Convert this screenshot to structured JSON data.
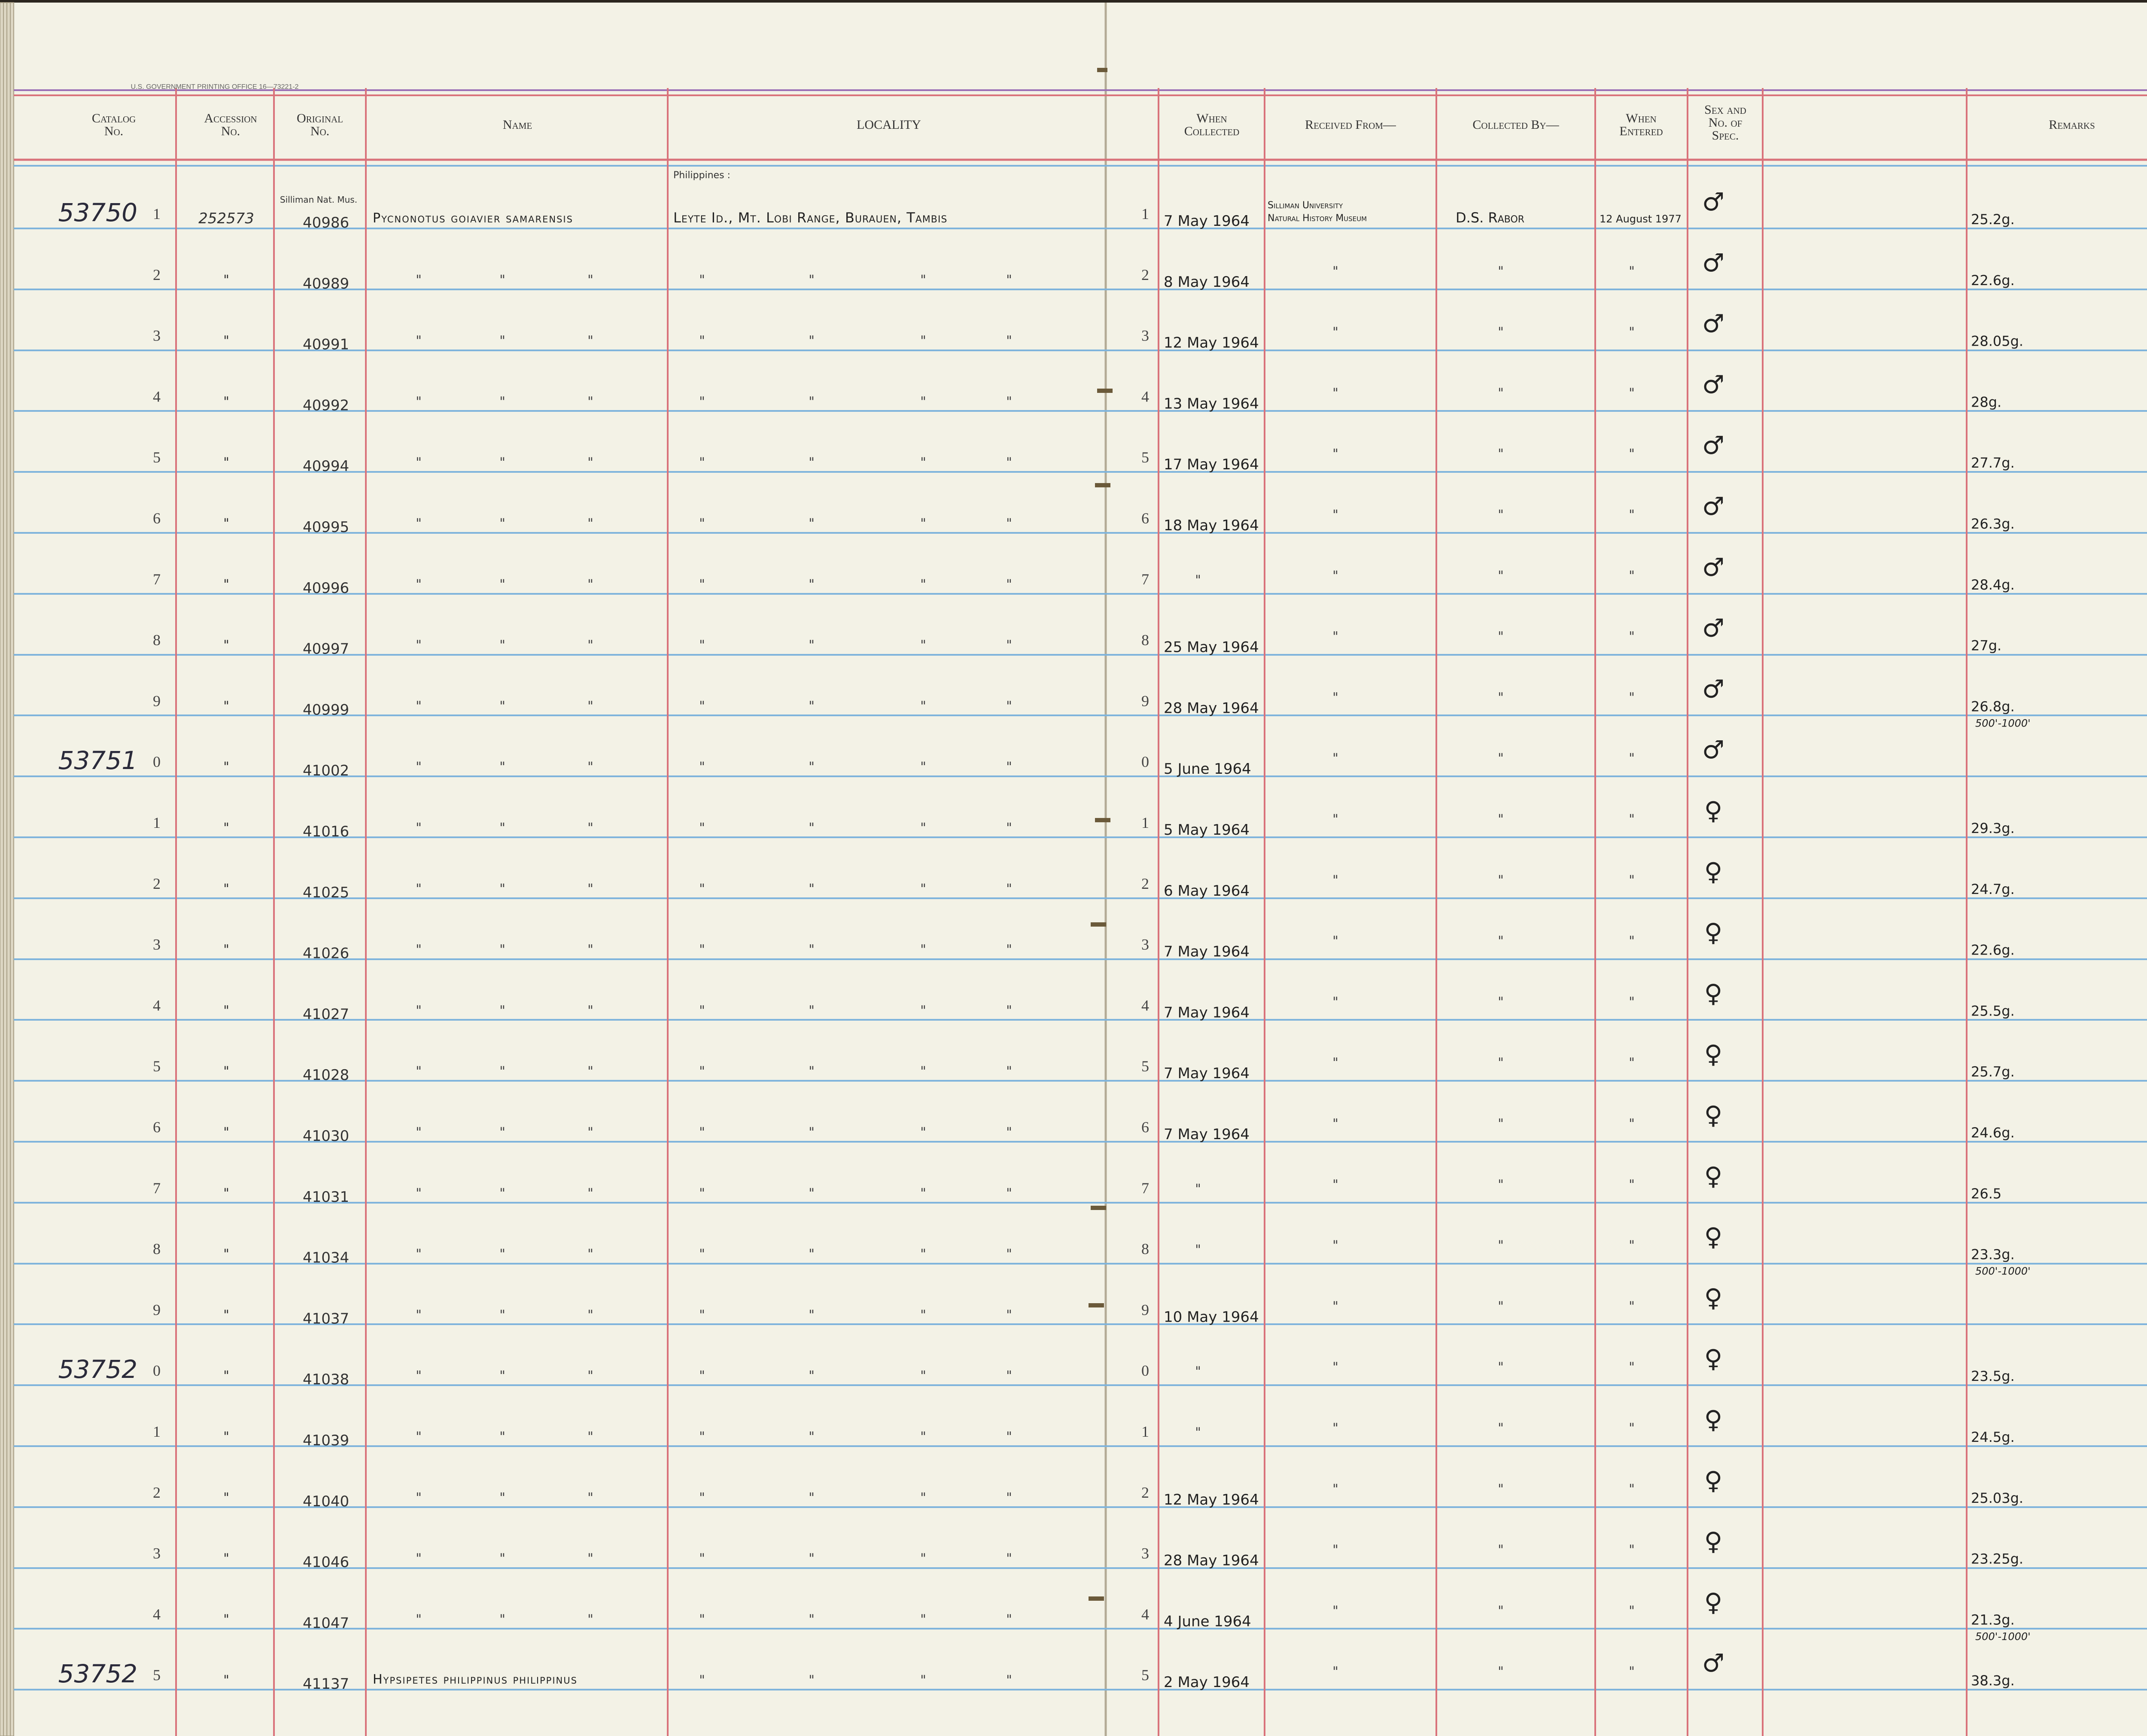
{
  "printer_line": "U.S. GOVERNMENT PRINTING OFFICE    16—73221-2",
  "headers": {
    "catalog": [
      "Catalog",
      "No."
    ],
    "accession": [
      "Accession",
      "No."
    ],
    "original": [
      "Original",
      "No."
    ],
    "name": [
      "Name"
    ],
    "locality": [
      "LOCALITY"
    ],
    "when_collected": [
      "When",
      "Collected"
    ],
    "received_from": [
      "Received From—"
    ],
    "collected_by": [
      "Collected By—"
    ],
    "when_entered": [
      "When",
      "Entered"
    ],
    "sex": [
      "Sex and",
      "No. of",
      "Spec."
    ],
    "remarks": [
      "Remarks"
    ]
  },
  "annotations": {
    "original_header_note": "Silliman Nat. Mus.",
    "locality_header_note": "Philippines :"
  },
  "rows": [
    {
      "cat_base": "53750",
      "digit": "1",
      "acc": "252573",
      "orig": "40986",
      "name": "Pycnonotus goiavier samarensis",
      "locality": "Leyte Id., Mt. Lobi Range, Burauen, Tambis",
      "rdigit": "1",
      "date": "7 May 1964",
      "received": "Silliman University Natural History Museum",
      "collector": "D.S. Rabor",
      "entered": "12 August 1977",
      "sex": "♂",
      "remarks": "25.2g."
    },
    {
      "cat_base": "",
      "digit": "2",
      "acc": "\"",
      "orig": "40989",
      "name": "\"",
      "locality": "\"",
      "rdigit": "2",
      "date": "8 May 1964",
      "received": "\"",
      "collector": "\"",
      "entered": "\"",
      "sex": "♂",
      "remarks": "22.6g."
    },
    {
      "cat_base": "",
      "digit": "3",
      "acc": "\"",
      "orig": "40991",
      "name": "\"",
      "locality": "\"",
      "rdigit": "3",
      "date": "12 May 1964",
      "received": "\"",
      "collector": "\"",
      "entered": "\"",
      "sex": "♂",
      "remarks": "28.05g."
    },
    {
      "cat_base": "",
      "digit": "4",
      "acc": "\"",
      "orig": "40992",
      "name": "\"",
      "locality": "\"",
      "rdigit": "4",
      "date": "13 May 1964",
      "received": "\"",
      "collector": "\"",
      "entered": "\"",
      "sex": "♂",
      "remarks": "28g."
    },
    {
      "cat_base": "",
      "digit": "5",
      "acc": "\"",
      "orig": "40994",
      "name": "\"",
      "locality": "\"",
      "rdigit": "5",
      "date": "17 May 1964",
      "received": "\"",
      "collector": "\"",
      "entered": "\"",
      "sex": "♂",
      "remarks": "27.7g."
    },
    {
      "cat_base": "",
      "digit": "6",
      "acc": "\"",
      "orig": "40995",
      "name": "\"",
      "locality": "\"",
      "rdigit": "6",
      "date": "18 May 1964",
      "received": "\"",
      "collector": "\"",
      "entered": "\"",
      "sex": "♂",
      "remarks": "26.3g."
    },
    {
      "cat_base": "",
      "digit": "7",
      "acc": "\"",
      "orig": "40996",
      "name": "\"",
      "locality": "\"",
      "rdigit": "7",
      "date": "\"",
      "received": "\"",
      "collector": "\"",
      "entered": "\"",
      "sex": "♂",
      "remarks": "28.4g."
    },
    {
      "cat_base": "",
      "digit": "8",
      "acc": "\"",
      "orig": "40997",
      "name": "\"",
      "locality": "\"",
      "rdigit": "8",
      "date": "25 May 1964",
      "received": "\"",
      "collector": "\"",
      "entered": "\"",
      "sex": "♂",
      "remarks": "27g."
    },
    {
      "cat_base": "",
      "digit": "9",
      "acc": "\"",
      "orig": "40999",
      "name": "\"",
      "locality": "\"",
      "rdigit": "9",
      "date": "28 May 1964",
      "received": "\"",
      "collector": "\"",
      "entered": "\"",
      "sex": "♂",
      "remarks": "26.8g.",
      "remarks2": "500'-1000'"
    },
    {
      "cat_base": "53751",
      "digit": "0",
      "acc": "\"",
      "orig": "41002",
      "name": "\"",
      "locality": "\"",
      "rdigit": "0",
      "date": "5 June 1964",
      "received": "\"",
      "collector": "\"",
      "entered": "\"",
      "sex": "♂",
      "remarks": ""
    },
    {
      "cat_base": "",
      "digit": "1",
      "acc": "\"",
      "orig": "41016",
      "name": "\"",
      "locality": "\"",
      "rdigit": "1",
      "date": "5 May 1964",
      "received": "\"",
      "collector": "\"",
      "entered": "\"",
      "sex": "♀",
      "remarks": "29.3g."
    },
    {
      "cat_base": "",
      "digit": "2",
      "acc": "\"",
      "orig": "41025",
      "name": "\"",
      "locality": "\"",
      "rdigit": "2",
      "date": "6 May 1964",
      "received": "\"",
      "collector": "\"",
      "entered": "\"",
      "sex": "♀",
      "remarks": "24.7g."
    },
    {
      "cat_base": "",
      "digit": "3",
      "acc": "\"",
      "orig": "41026",
      "name": "\"",
      "locality": "\"",
      "rdigit": "3",
      "date": "7 May 1964",
      "received": "\"",
      "collector": "\"",
      "entered": "\"",
      "sex": "♀",
      "remarks": "22.6g."
    },
    {
      "cat_base": "",
      "digit": "4",
      "acc": "\"",
      "orig": "41027",
      "name": "\"",
      "locality": "\"",
      "rdigit": "4",
      "date": "7 May 1964",
      "received": "\"",
      "collector": "\"",
      "entered": "\"",
      "sex": "♀",
      "remarks": "25.5g."
    },
    {
      "cat_base": "",
      "digit": "5",
      "acc": "\"",
      "orig": "41028",
      "name": "\"",
      "locality": "\"",
      "rdigit": "5",
      "date": "7 May 1964",
      "received": "\"",
      "collector": "\"",
      "entered": "\"",
      "sex": "♀",
      "remarks": "25.7g."
    },
    {
      "cat_base": "",
      "digit": "6",
      "acc": "\"",
      "orig": "41030",
      "name": "\"",
      "locality": "\"",
      "rdigit": "6",
      "date": "7 May 1964",
      "received": "\"",
      "collector": "\"",
      "entered": "\"",
      "sex": "♀",
      "remarks": "24.6g."
    },
    {
      "cat_base": "",
      "digit": "7",
      "acc": "\"",
      "orig": "41031",
      "name": "\"",
      "locality": "\"",
      "rdigit": "7",
      "date": "\"",
      "received": "\"",
      "collector": "\"",
      "entered": "\"",
      "sex": "♀",
      "remarks": "26.5"
    },
    {
      "cat_base": "",
      "digit": "8",
      "acc": "\"",
      "orig": "41034",
      "name": "\"",
      "locality": "\"",
      "rdigit": "8",
      "date": "\"",
      "received": "\"",
      "collector": "\"",
      "entered": "\"",
      "sex": "♀",
      "remarks": "23.3g.",
      "remarks2": "500'-1000'"
    },
    {
      "cat_base": "",
      "digit": "9",
      "acc": "\"",
      "orig": "41037",
      "name": "\"",
      "locality": "\"",
      "rdigit": "9",
      "date": "10 May 1964",
      "received": "\"",
      "collector": "\"",
      "entered": "\"",
      "sex": "♀",
      "remarks": ""
    },
    {
      "cat_base": "53752",
      "digit": "0",
      "acc": "\"",
      "orig": "41038",
      "name": "\"",
      "locality": "\"",
      "rdigit": "0",
      "date": "\"",
      "received": "\"",
      "collector": "\"",
      "entered": "\"",
      "sex": "♀",
      "remarks": "23.5g."
    },
    {
      "cat_base": "",
      "digit": "1",
      "acc": "\"",
      "orig": "41039",
      "name": "\"",
      "locality": "\"",
      "rdigit": "1",
      "date": "\"",
      "received": "\"",
      "collector": "\"",
      "entered": "\"",
      "sex": "♀",
      "remarks": "24.5g."
    },
    {
      "cat_base": "",
      "digit": "2",
      "acc": "\"",
      "orig": "41040",
      "name": "\"",
      "locality": "\"",
      "rdigit": "2",
      "date": "12 May 1964",
      "received": "\"",
      "collector": "\"",
      "entered": "\"",
      "sex": "♀",
      "remarks": "25.03g."
    },
    {
      "cat_base": "",
      "digit": "3",
      "acc": "\"",
      "orig": "41046",
      "name": "\"",
      "locality": "\"",
      "rdigit": "3",
      "date": "28 May 1964",
      "received": "\"",
      "collector": "\"",
      "entered": "\"",
      "sex": "♀",
      "remarks": "23.25g."
    },
    {
      "cat_base": "",
      "digit": "4",
      "acc": "\"",
      "orig": "41047",
      "name": "\"",
      "locality": "\"",
      "rdigit": "4",
      "date": "4 June 1964",
      "received": "\"",
      "collector": "\"",
      "entered": "\"",
      "sex": "♀",
      "remarks": "21.3g.",
      "remarks2": "500'-1000'"
    },
    {
      "cat_base": "53752",
      "digit": "5",
      "acc": "\"",
      "orig": "41137",
      "name": "Hypsipetes philippinus philippinus",
      "locality": "\"",
      "rdigit": "5",
      "date": "2 May 1964",
      "received": "\"",
      "collector": "\"",
      "entered": "\"",
      "sex": "♂",
      "remarks": "38.3g."
    }
  ]
}
